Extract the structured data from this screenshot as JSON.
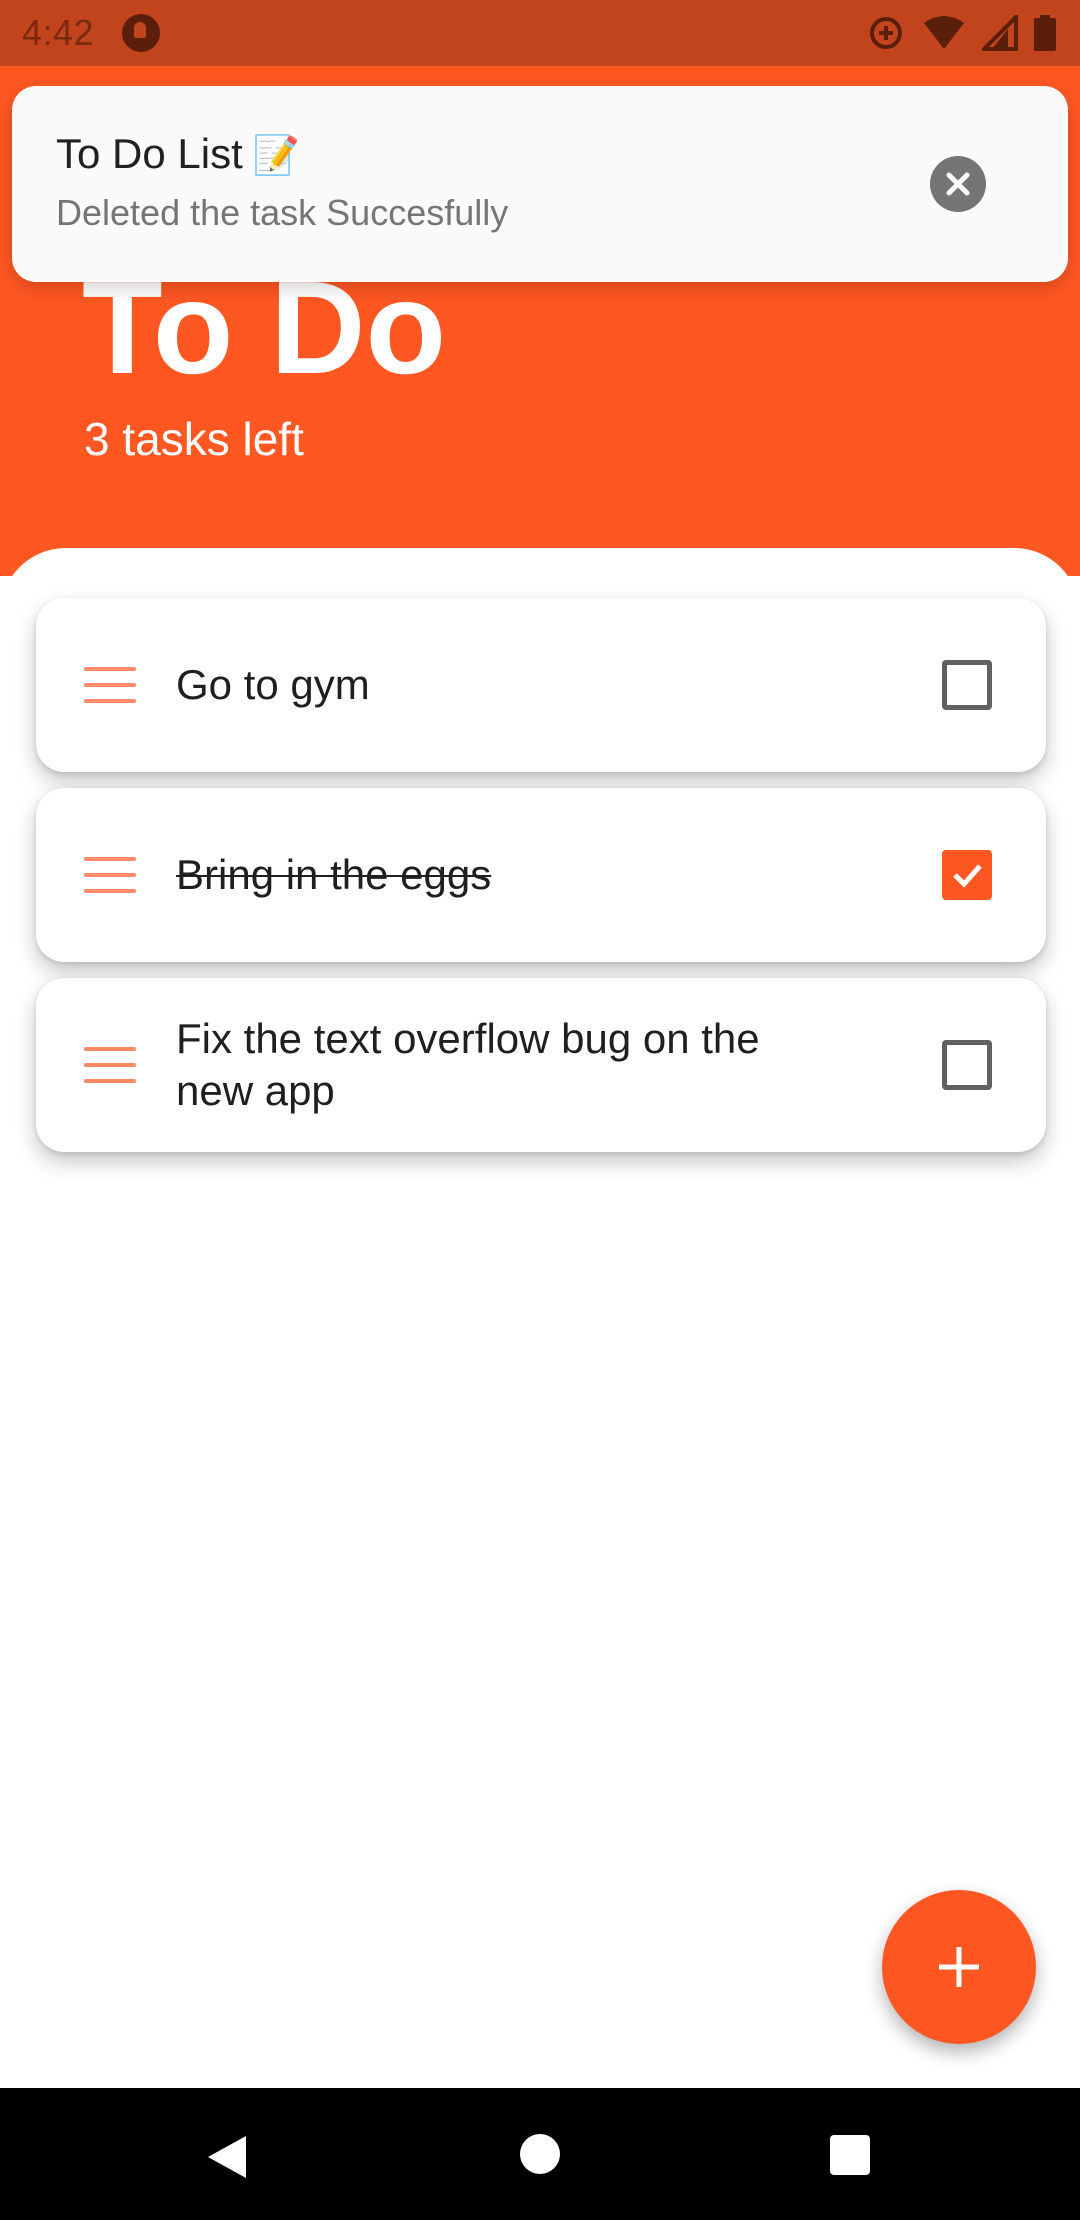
{
  "status_bar": {
    "time": "4:42",
    "icons": [
      "app-notification-icon",
      "data-saver-icon",
      "wifi-icon",
      "signal-icon",
      "battery-icon"
    ]
  },
  "header": {
    "title": "To Do",
    "subtitle": "3 tasks left"
  },
  "toast": {
    "title": "To Do List",
    "emoji": "📝",
    "message": "Deleted the task Succesfully"
  },
  "tasks": [
    {
      "text": "Go to gym",
      "completed": false
    },
    {
      "text": "Bring in the eggs",
      "completed": true
    },
    {
      "text": "Fix the text overflow bug on the new app",
      "completed": false
    }
  ],
  "fab": {
    "icon": "plus-icon"
  },
  "navigation": {
    "buttons": [
      "back-icon",
      "home-icon",
      "recents-icon"
    ]
  },
  "colors": {
    "primary": "#ff5722",
    "status_bar": "#c1441d",
    "drag_handle": "#ff8a65",
    "checkbox_border": "#616161"
  }
}
